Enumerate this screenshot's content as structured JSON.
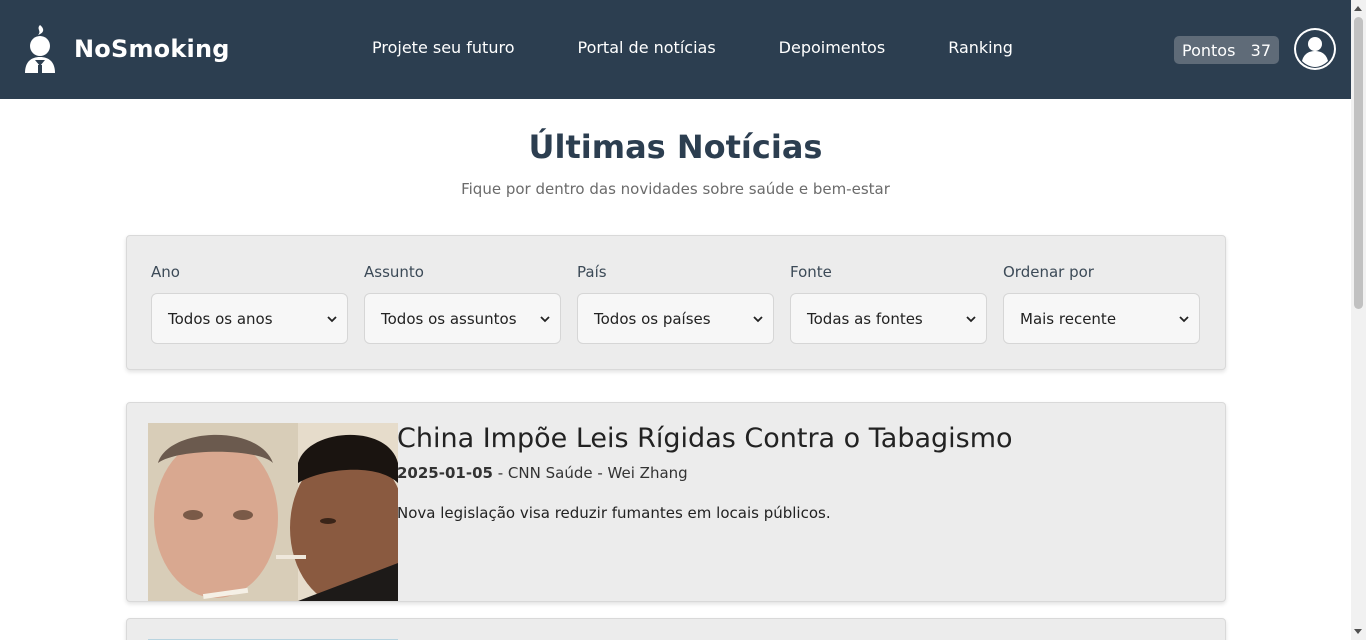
{
  "brand": {
    "name": "NoSmoking",
    "logo_icon": "smoking-person-logo-icon"
  },
  "nav": {
    "links": [
      "Projete seu futuro",
      "Portal de notícias",
      "Depoimentos",
      "Ranking"
    ]
  },
  "points": {
    "label": "Pontos",
    "value": "37"
  },
  "page": {
    "title": "Últimas Notícias",
    "subtitle": "Fique por dentro das novidades sobre saúde e bem-estar"
  },
  "filters": [
    {
      "label": "Ano",
      "selected": "Todos os anos"
    },
    {
      "label": "Assunto",
      "selected": "Todos os assuntos"
    },
    {
      "label": "País",
      "selected": "Todos os países"
    },
    {
      "label": "Fonte",
      "selected": "Todas as fontes"
    },
    {
      "label": "Ordenar por",
      "selected": "Mais recente"
    }
  ],
  "articles": [
    {
      "title": "China Impõe Leis Rígidas Contra o Tabagismo",
      "date": "2025-01-05",
      "source": "CNN Saúde",
      "author": "Wei Zhang",
      "description": "Nova legislação visa reduzir fumantes em locais públicos."
    }
  ],
  "colors": {
    "navbar": "#2c3e50",
    "card_bg": "#ececec",
    "points_bg": "#5f6b78"
  }
}
